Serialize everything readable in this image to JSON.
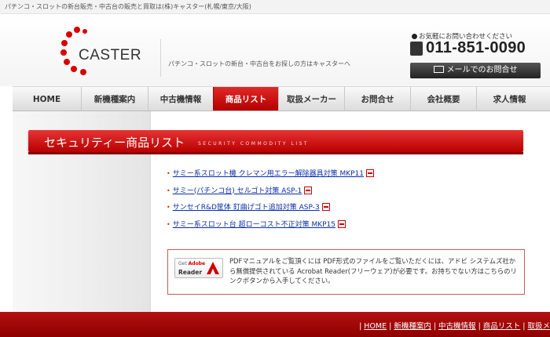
{
  "top_bar": {
    "text": "パチンコ・スロットの新台販売・中古台の販売と買取は(株)キャスター(札幌/東京/大阪)"
  },
  "header": {
    "logo_text": "CASTER",
    "tagline": "パチンコ・スロットの新台・中古台をお探しの方はキャスターへ",
    "contact_label": "お気軽にお問い合わせください",
    "phone": "011-851-0090",
    "mail_button": "メールでのお問合せ"
  },
  "nav": {
    "items": [
      {
        "label": "HOME"
      },
      {
        "label": "新機種案内"
      },
      {
        "label": "中古機情報"
      },
      {
        "label": "商品リスト"
      },
      {
        "label": "取扱メーカー"
      },
      {
        "label": "お問合せ"
      },
      {
        "label": "会社概要"
      },
      {
        "label": "求人情報"
      }
    ],
    "active_index": 3,
    "accent_color": "#cc0000"
  },
  "section": {
    "title": "セキュリティー商品リスト",
    "subtitle": "SECURITY COMMODITY LIST"
  },
  "products": [
    {
      "label": "サミー系スロット機 クレマン用エラー解除器具対策 MKP11",
      "icon": "pdf-icon"
    },
    {
      "label": "サミー(パチンコ台) セルゴト対策 ASP-1",
      "icon": "pdf-icon"
    },
    {
      "label": "サンセイR&D筐体 釘曲げゴト追加対策 ASP-3",
      "icon": "pdf-icon"
    },
    {
      "label": "サミー系スロット台 超ローコスト不正対策 MKP15",
      "icon": "pdf-icon"
    }
  ],
  "adobe": {
    "badge_get": "Get",
    "badge_brand": "Adobe",
    "badge_reader": "Reader",
    "text": "PDFマニュアルをご覧頂くには PDF形式のファイルをご覧いただくには、アドビ システムズ社から無償提供されている Acrobat Reader(フリーウェア)が必要です。お持ちでない方はこちらのリンクボタンから入手してください。"
  },
  "footer": {
    "links": [
      "HOME",
      "新機種案内",
      "中古機情報",
      "商品リスト",
      "取扱メ"
    ]
  }
}
